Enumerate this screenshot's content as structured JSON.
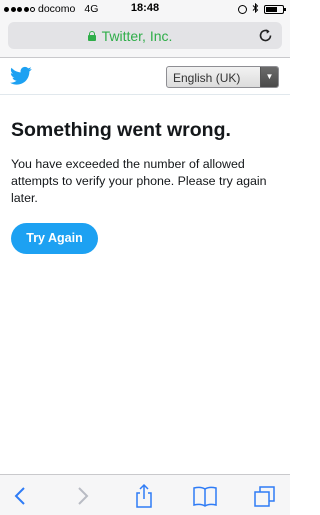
{
  "status_bar": {
    "carrier": "docomo",
    "network": "4G",
    "time": "18:48",
    "icons": [
      "signal-dots-icon",
      "alarm-icon",
      "bluetooth-icon",
      "battery-icon"
    ]
  },
  "browser": {
    "url_title": "Twitter, Inc.",
    "icons": {
      "lock": "lock-icon",
      "reload": "reload-icon"
    },
    "toolbar": [
      "back-icon",
      "forward-icon",
      "share-icon",
      "bookmarks-icon",
      "tabs-icon"
    ]
  },
  "header": {
    "logo_icon": "twitter-bird-icon",
    "language_selected": "English (UK)"
  },
  "main": {
    "heading": "Something went wrong.",
    "message": "You have exceeded the number of allowed attempts to verify your phone. Please try again later.",
    "button_label": "Try Again"
  },
  "colors": {
    "brand": "#1da1f2",
    "secure_green": "#2fae49",
    "ios_blue": "#2f7cf6"
  }
}
